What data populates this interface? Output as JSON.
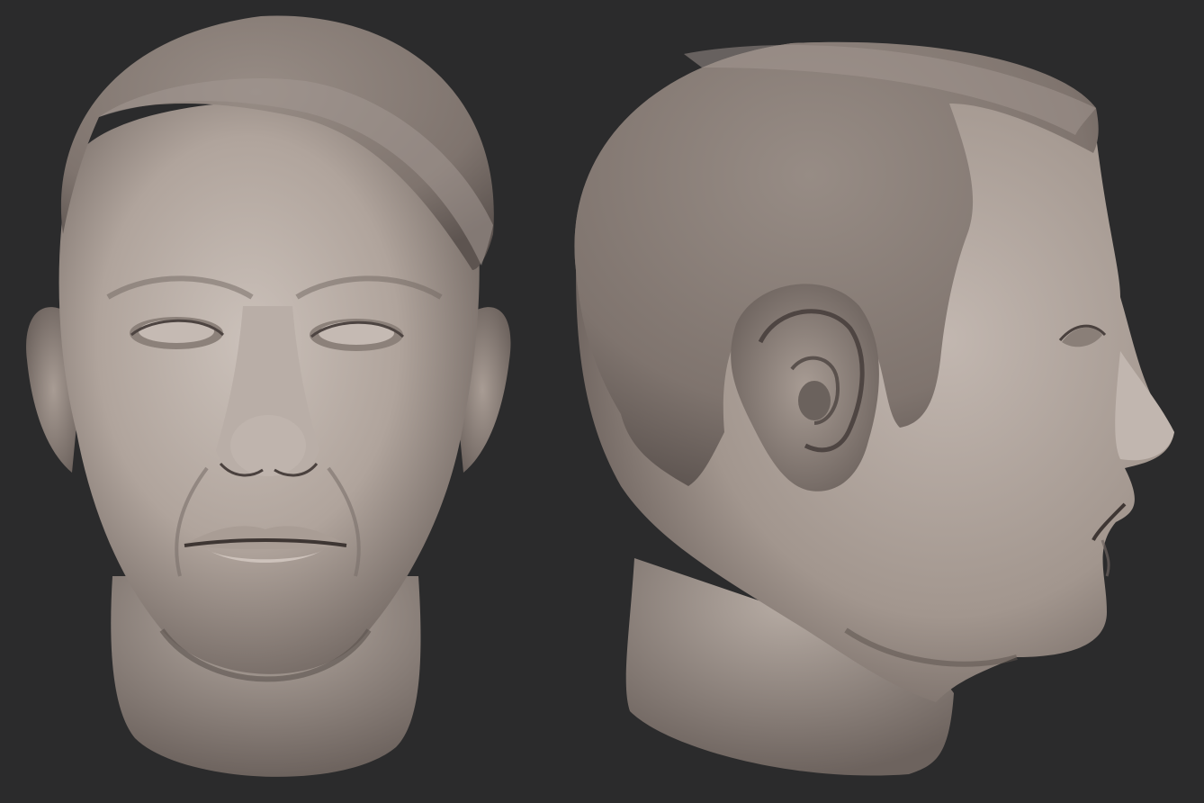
{
  "scene": {
    "colors": {
      "background": "#2b2b2c",
      "skin_light": "#c6bbb4",
      "skin_mid": "#a2958c",
      "skin_dark": "#5e5450",
      "hair_cap": "#8d827b",
      "hair_cap_dark": "#6f655f",
      "shadow_line": "#3a3230"
    },
    "views": [
      {
        "id": "front",
        "subject": "sculpted-head-front-view"
      },
      {
        "id": "side",
        "subject": "sculpted-head-right-profile-view"
      }
    ]
  }
}
